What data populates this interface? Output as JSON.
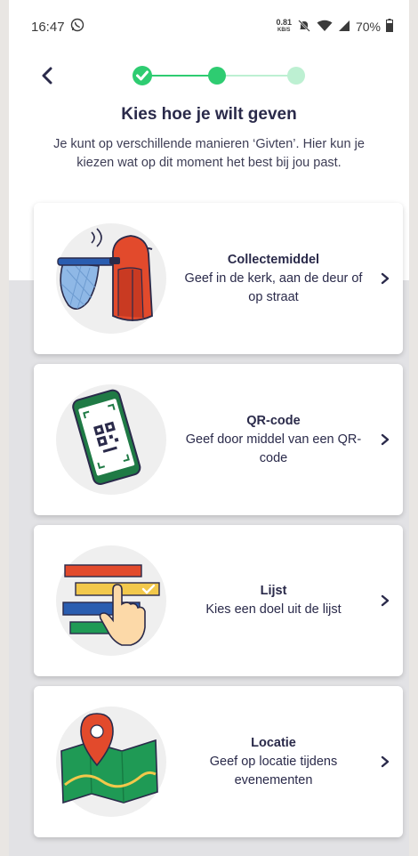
{
  "status_bar": {
    "time": "16:47",
    "net_speed": "0.81",
    "net_unit": "KB/S",
    "battery": "70%"
  },
  "header": {
    "title": "Kies hoe je wilt geven",
    "subtitle": "Je kunt op verschillende manieren ‘Givten’. Hier kun je kiezen wat op dit moment het best bij jou past."
  },
  "stepper": {
    "current_step": 2,
    "total_steps": 3
  },
  "options": [
    {
      "title": "Collectemiddel",
      "description": "Geef in de kerk, aan de deur of op straat",
      "icon": "collection-bag-icon"
    },
    {
      "title": "QR-code",
      "description": "Geef door middel van een QR-code",
      "icon": "qr-phone-icon"
    },
    {
      "title": "Lijst",
      "description": "Kies een doel uit de lijst",
      "icon": "list-select-icon"
    },
    {
      "title": "Locatie",
      "description": "Geef op locatie tijdens evenementen",
      "icon": "map-pin-icon"
    }
  ],
  "colors": {
    "accent_green": "#2ecc71",
    "text_dark": "#2a2a4a",
    "bottom_gray": "#e2e2e5"
  }
}
